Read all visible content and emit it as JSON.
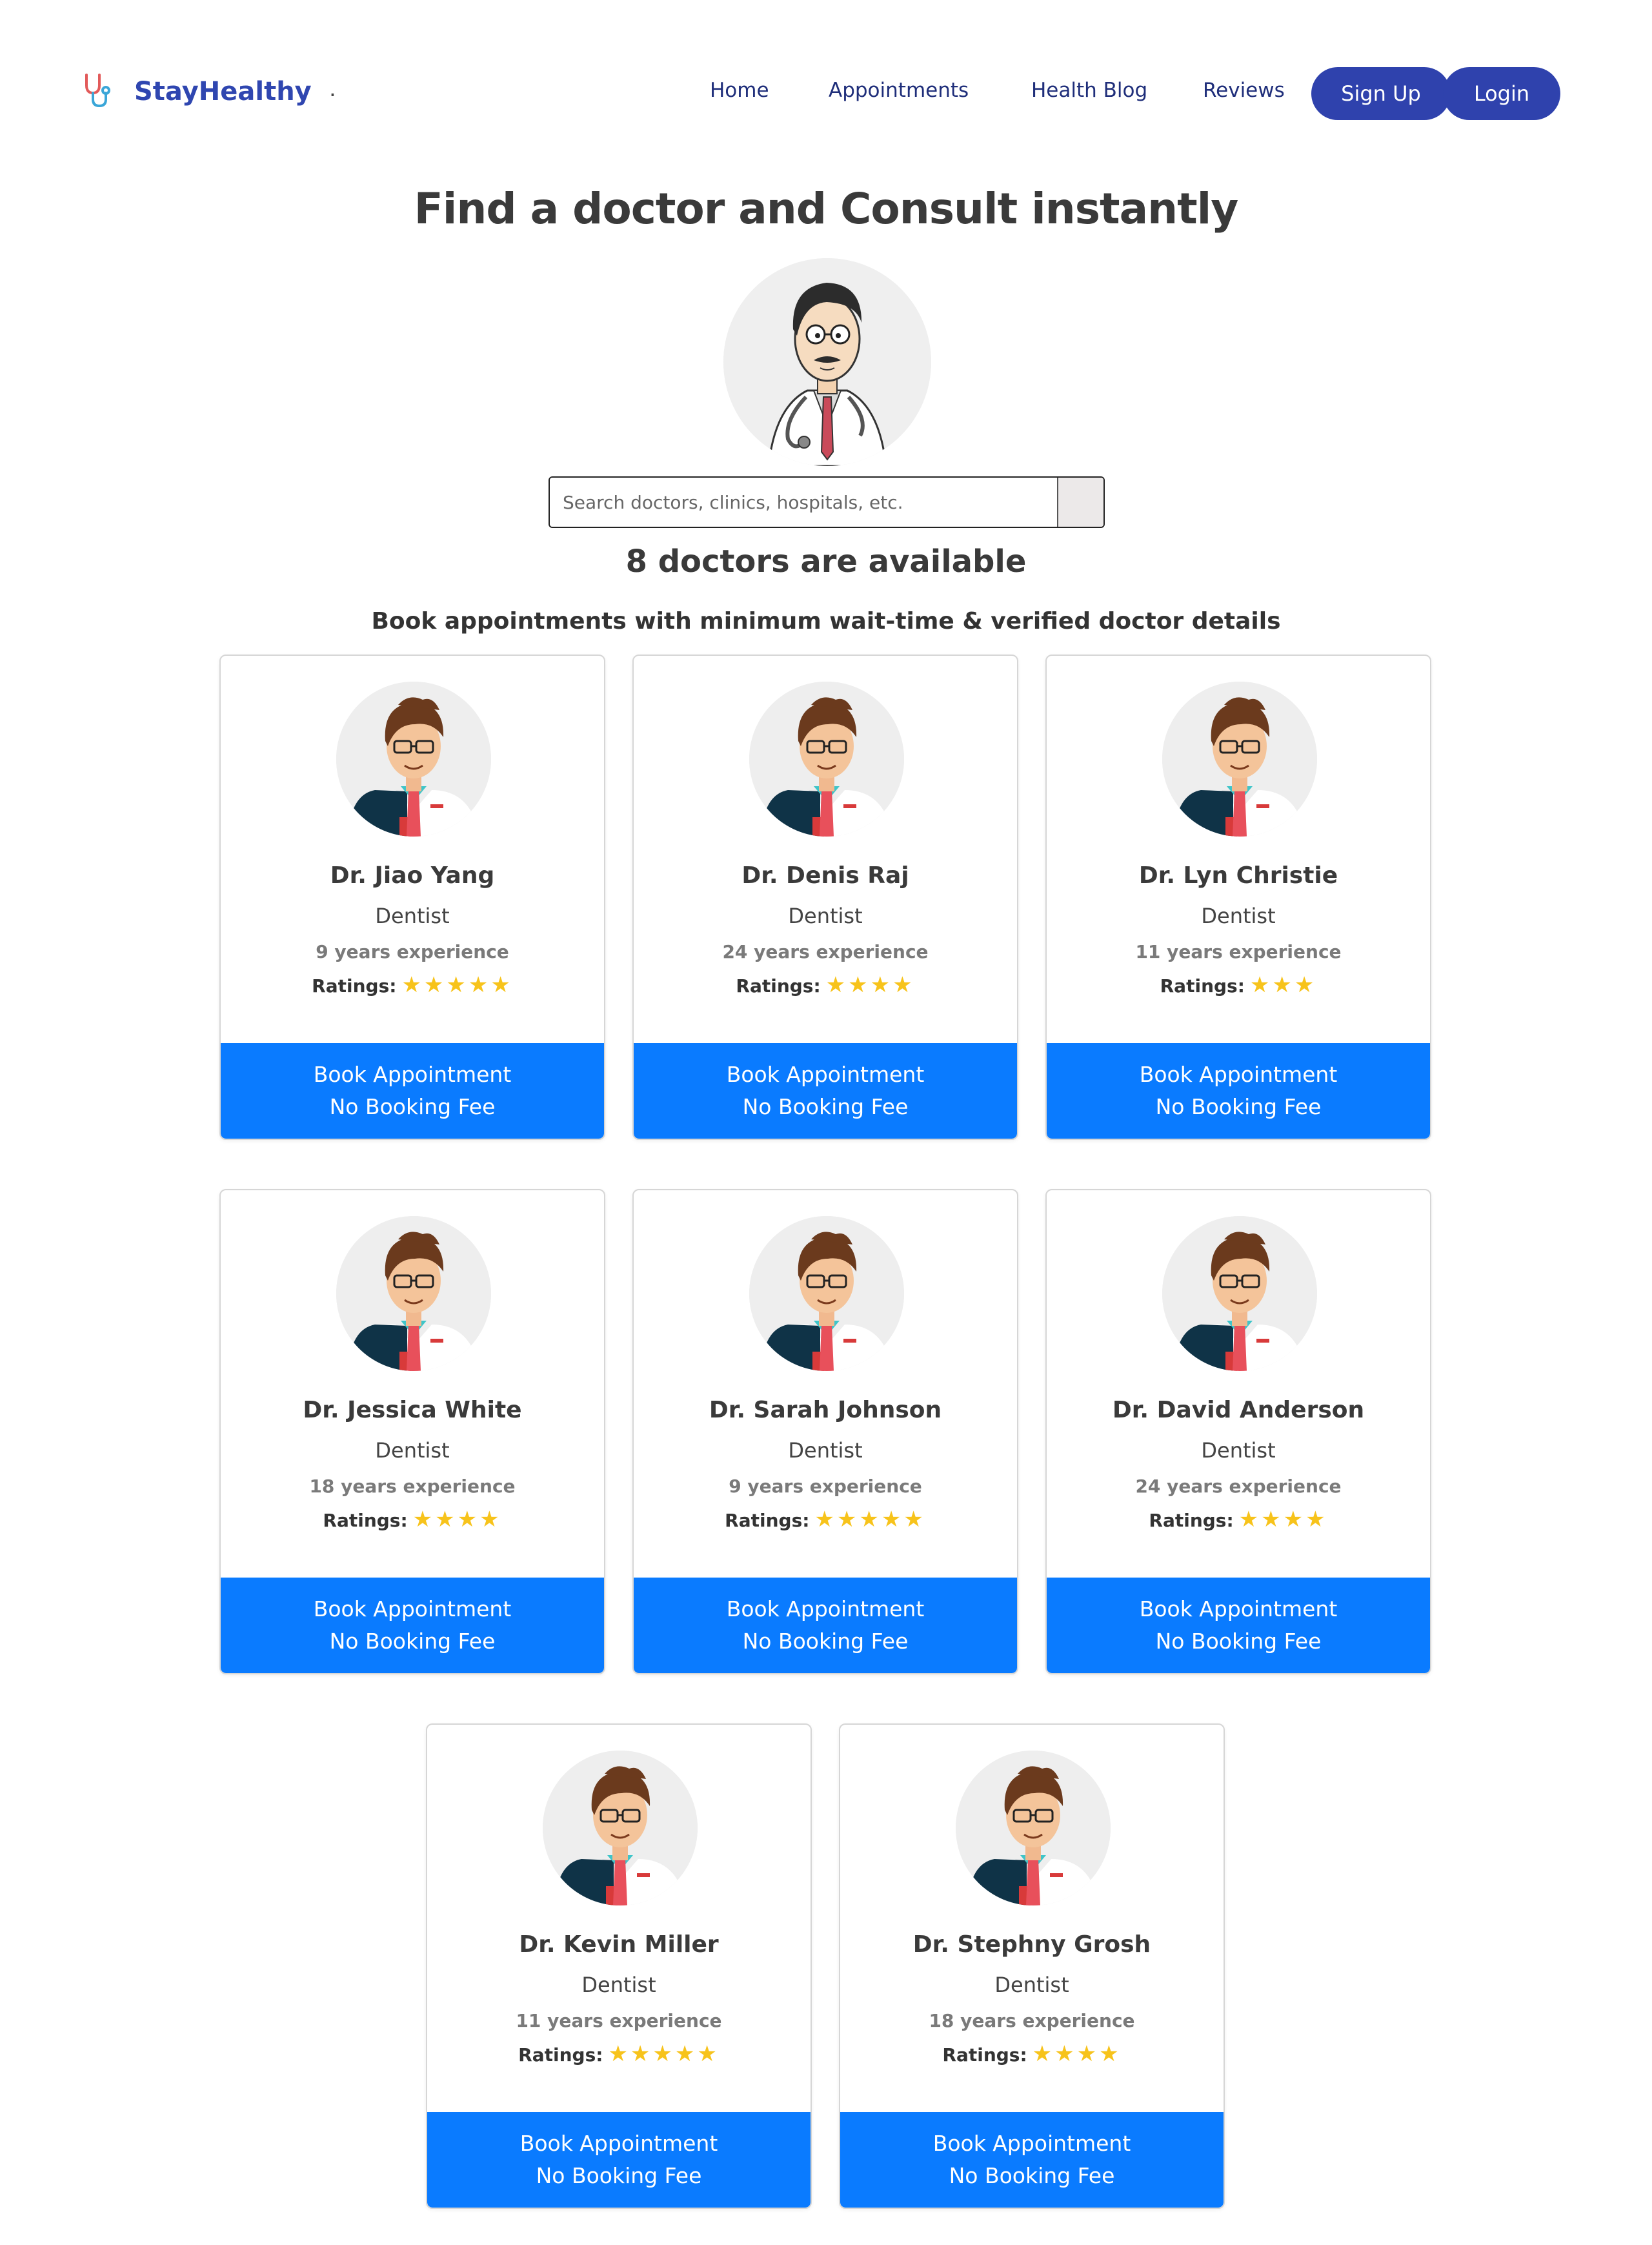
{
  "header": {
    "brand_name": "StayHealthy",
    "brand_dot": ".",
    "nav": [
      "Home",
      "Appointments",
      "Health Blog",
      "Reviews"
    ],
    "signup_label": "Sign Up",
    "login_label": "Login"
  },
  "hero": {
    "title": "Find a doctor and Consult instantly",
    "search_placeholder": "Search doctors, clinics, hospitals, etc."
  },
  "results": {
    "count_text": "8 doctors are available",
    "subtitle": "Book appointments with minimum wait-time & verified doctor details",
    "ratings_label": "Ratings:",
    "book_line1": "Book Appointment",
    "book_line2": "No Booking Fee"
  },
  "doctors": [
    {
      "name": "Dr. Jiao Yang",
      "specialty": "Dentist",
      "experience": "9 years experience",
      "rating": 5
    },
    {
      "name": "Dr. Denis Raj",
      "specialty": "Dentist",
      "experience": "24 years experience",
      "rating": 4
    },
    {
      "name": "Dr. Lyn Christie",
      "specialty": "Dentist",
      "experience": "11 years experience",
      "rating": 3
    },
    {
      "name": "Dr. Jessica White",
      "specialty": "Dentist",
      "experience": "18 years experience",
      "rating": 4
    },
    {
      "name": "Dr. Sarah Johnson",
      "specialty": "Dentist",
      "experience": "9 years experience",
      "rating": 5
    },
    {
      "name": "Dr. David Anderson",
      "specialty": "Dentist",
      "experience": "24 years experience",
      "rating": 4
    },
    {
      "name": "Dr. Kevin Miller",
      "specialty": "Dentist",
      "experience": "11 years experience",
      "rating": 5
    },
    {
      "name": "Dr. Stephny Grosh",
      "specialty": "Dentist",
      "experience": "18 years experience",
      "rating": 4
    }
  ],
  "colors": {
    "brand": "#2f46b0",
    "nav_button": "#2f42ad",
    "book_button": "#0a7bff",
    "star": "#f7c31b"
  }
}
